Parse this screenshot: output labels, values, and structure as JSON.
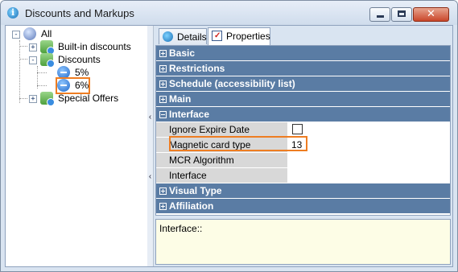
{
  "window": {
    "title": "Discounts and Markups"
  },
  "tree": {
    "root": "All",
    "items": [
      {
        "label": "Built-in discounts"
      },
      {
        "label": "Discounts"
      },
      {
        "label": "5%"
      },
      {
        "label": "6%"
      },
      {
        "label": "Special Offers"
      }
    ]
  },
  "tabs": [
    {
      "label": "Details"
    },
    {
      "label": "Properties"
    }
  ],
  "grid": {
    "categories": {
      "basic": "Basic",
      "restrictions": "Restrictions",
      "schedule": "Schedule (accessibility list)",
      "main": "Main",
      "interface": "Interface",
      "visual_type": "Visual Type",
      "affiliation": "Affiliation"
    },
    "properties": [
      {
        "name": "Ignore Expire Date",
        "value": ""
      },
      {
        "name": "Magnetic card type",
        "value": "13"
      },
      {
        "name": "MCR Algorithm",
        "value": ""
      },
      {
        "name": "Interface",
        "value": ""
      }
    ],
    "ignore_expire_checked": false
  },
  "description": "Interface::",
  "colors": {
    "highlight": "#ee7d22",
    "category_bar": "#5a7ca4"
  }
}
